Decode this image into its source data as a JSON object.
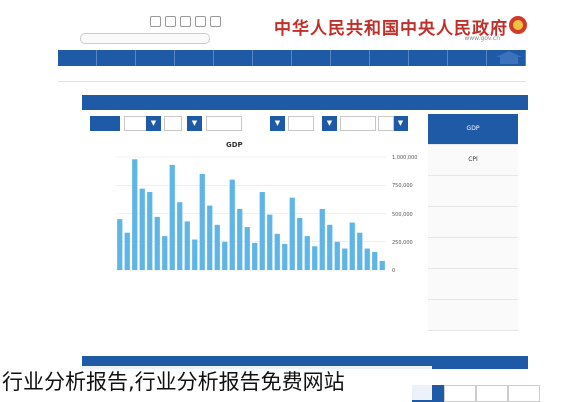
{
  "header": {
    "top_links": "",
    "site_title": "中华人民共和国中央人民政府",
    "site_domain": "www.gov.cn"
  },
  "nav": {
    "items": [
      "",
      "",
      "",
      "",
      "",
      "",
      "",
      "",
      "",
      "",
      "",
      ""
    ]
  },
  "breadcrumb": "",
  "panel": {
    "title": "",
    "controls": {
      "indicator": "",
      "start_year": "",
      "range_word": "",
      "end_period": "",
      "period_type": "",
      "query_button": ""
    },
    "chart_note": ""
  },
  "chart_data": {
    "type": "bar",
    "title": "GDP",
    "unit_label": "",
    "ylim": [
      0,
      1000000
    ],
    "yticks": [
      "1,000,000",
      "750,000",
      "500,000",
      "250,000",
      "0"
    ],
    "x_tick_labels": [
      "",
      "",
      "",
      "",
      "",
      "",
      "",
      "",
      "",
      "",
      ""
    ],
    "series": [
      {
        "color": "#5fb6e6",
        "values": [
          450000,
          330000,
          980000,
          720000,
          690000,
          470000,
          300000,
          930000,
          600000,
          430000,
          270000,
          850000,
          570000,
          400000,
          250000,
          800000,
          540000,
          380000,
          240000,
          690000,
          490000,
          320000,
          230000,
          640000,
          460000,
          300000,
          210000,
          540000,
          400000,
          250000,
          190000,
          420000,
          330000,
          190000,
          160000,
          80000
        ]
      }
    ],
    "legend": [
      "",
      "",
      "",
      "",
      "",
      ""
    ],
    "grid": true
  },
  "sidebar": {
    "items": [
      "GDP",
      "CPI",
      "",
      "",
      "",
      "",
      ""
    ],
    "active_index": 0
  },
  "footer_panel": {
    "title": "",
    "tabs": [
      "",
      "",
      "",
      ""
    ]
  },
  "watermark": "行业分析报告,行业分析报告免费网站"
}
